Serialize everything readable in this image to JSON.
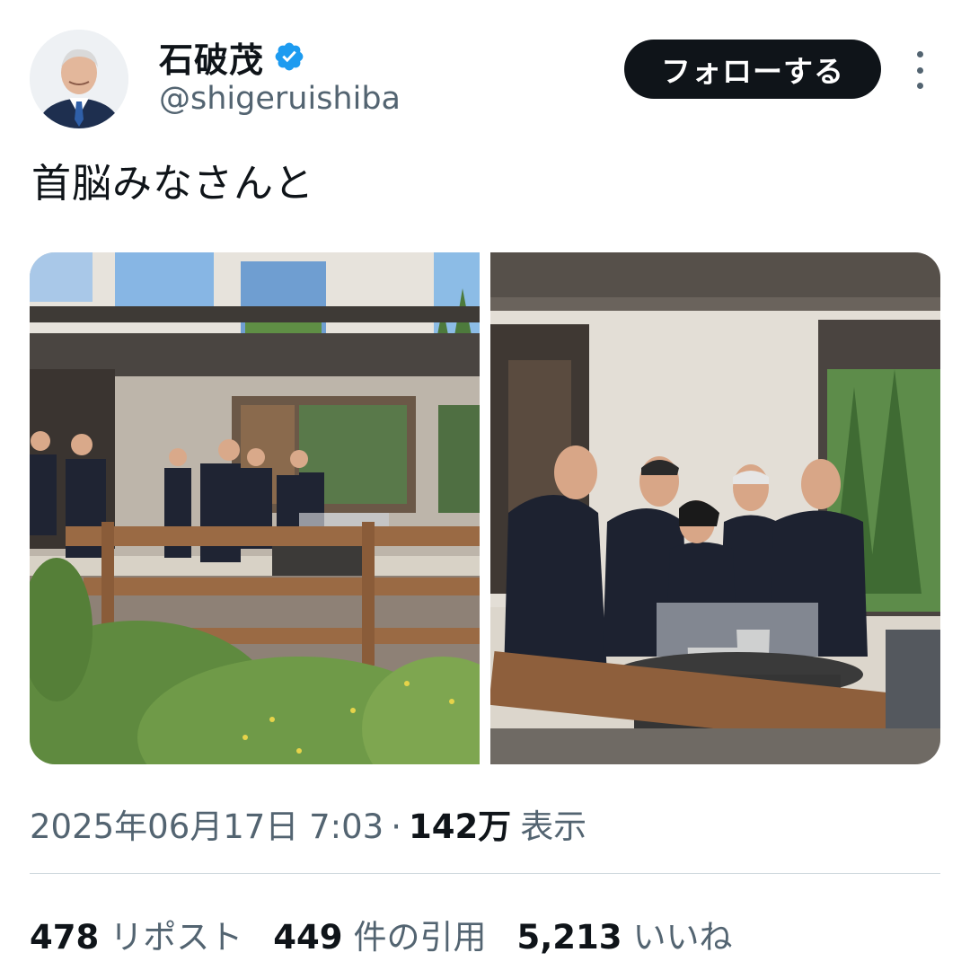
{
  "author": {
    "display_name": "石破茂",
    "handle": "@shigeruishiba",
    "verified_icon": "verified-badge-icon",
    "avatar": "profile-photo"
  },
  "follow_button": {
    "label": "フォローする"
  },
  "more_menu": {
    "icon": "more-vertical-icon"
  },
  "tweet": {
    "text": "首脳みなさんと"
  },
  "media": [
    {
      "kind": "photo",
      "description_icon": "photo-terrace-group"
    },
    {
      "kind": "photo",
      "description_icon": "photo-leaders-firepit"
    }
  ],
  "meta": {
    "timestamp": "2025年06月17日 7:03",
    "separator": "·",
    "views_count": "142万",
    "views_label": "表示"
  },
  "stats": {
    "reposts": {
      "count": "478",
      "label": "リポスト"
    },
    "quotes": {
      "count": "449",
      "label": "件の引用"
    },
    "likes": {
      "count": "5,213",
      "label": "いいね"
    }
  },
  "colors": {
    "text_primary": "#0f1419",
    "text_secondary": "#536471",
    "verified_blue": "#1d9bf0",
    "divider": "#cfd9de",
    "follow_bg": "#0f1419"
  }
}
